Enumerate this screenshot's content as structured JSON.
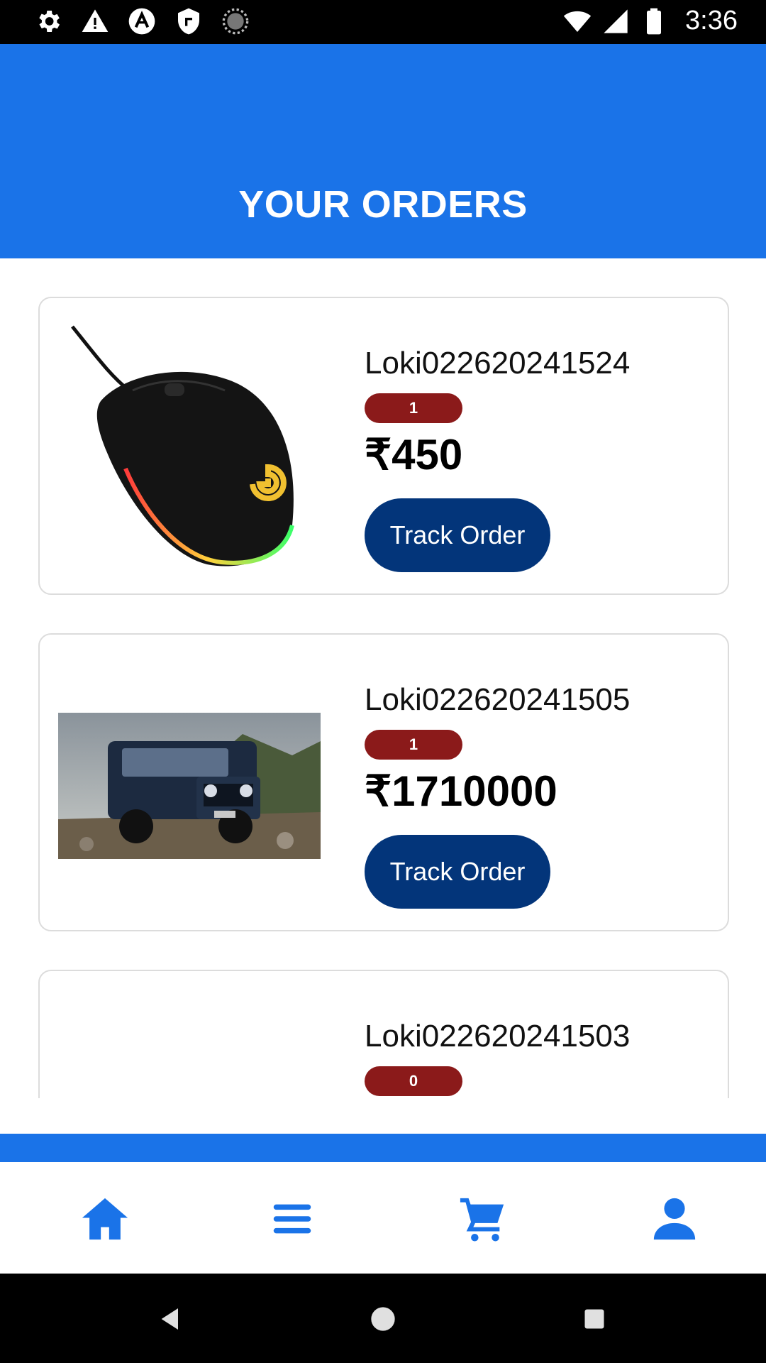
{
  "status_bar": {
    "time": "3:36",
    "left_icons": [
      "settings-icon",
      "warning-icon",
      "react-icon",
      "shield-icon",
      "sync-icon"
    ],
    "right_icons": [
      "wifi-icon",
      "signal-icon",
      "battery-icon"
    ]
  },
  "header": {
    "title": "YOUR ORDERS",
    "background": "#1a73e8"
  },
  "orders": [
    {
      "order_id": "Loki022620241524",
      "quantity": "1",
      "price": "₹450",
      "track_label": "Track Order",
      "image": "gaming-mouse-image"
    },
    {
      "order_id": "Loki022620241505",
      "quantity": "1",
      "price": "₹1710000",
      "track_label": "Track Order",
      "image": "suv-image"
    },
    {
      "order_id": "Loki022620241503",
      "quantity": "0",
      "price": "",
      "track_label": "",
      "image": ""
    }
  ],
  "bottom_nav": {
    "items": [
      {
        "icon": "home-icon"
      },
      {
        "icon": "menu-icon"
      },
      {
        "icon": "cart-icon"
      },
      {
        "icon": "profile-icon"
      }
    ],
    "accent": "#1a73e8"
  },
  "system_nav": [
    "back-icon",
    "home-circle-icon",
    "recents-icon"
  ],
  "colors": {
    "qty_pill": "#8b1a1a",
    "track_button": "#03357a"
  }
}
